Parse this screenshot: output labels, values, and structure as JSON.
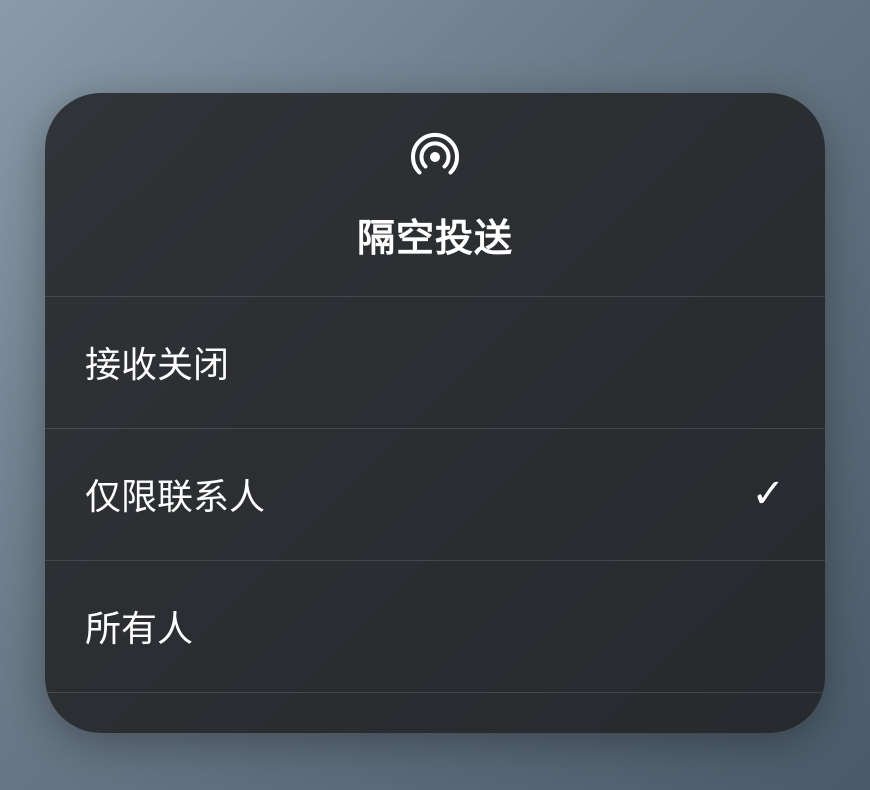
{
  "header": {
    "icon": "airdrop-icon",
    "title": "隔空投送"
  },
  "options": [
    {
      "label": "接收关闭",
      "selected": false
    },
    {
      "label": "仅限联系人",
      "selected": true
    },
    {
      "label": "所有人",
      "selected": false
    }
  ]
}
